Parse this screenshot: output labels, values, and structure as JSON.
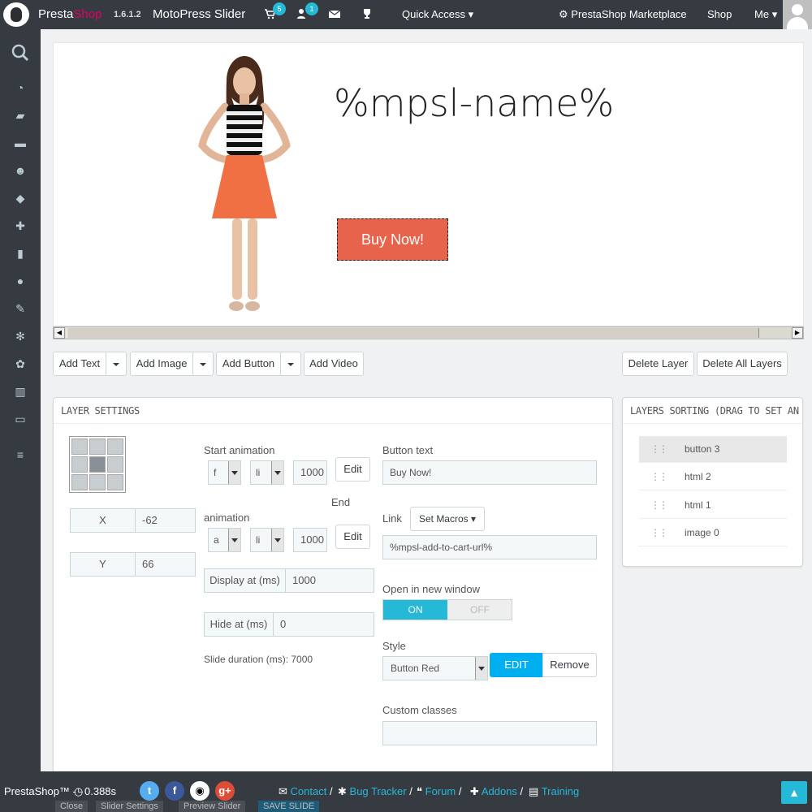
{
  "header": {
    "brand_first": "Presta",
    "brand_second": "Shop",
    "version": "1.6.1.2",
    "page_title": "MotoPress Slider",
    "cart_count": "5",
    "customers_count": "1",
    "quick_access": "Quick Access",
    "marketplace": "PrestaShop Marketplace",
    "shop": "Shop",
    "me": "Me"
  },
  "preview": {
    "title": "%mpsl-name%",
    "button": "Buy Now!"
  },
  "toolbar": {
    "add_text": "Add Text",
    "add_image": "Add Image",
    "add_button": "Add Button",
    "add_video": "Add Video",
    "delete_layer": "Delete Layer",
    "delete_all": "Delete All Layers"
  },
  "layer_settings": {
    "title": "LAYER SETTINGS",
    "x_label": "X",
    "x_value": "-62",
    "y_label": "Y",
    "y_value": "66",
    "start_animation_label": "Start animation",
    "start_effect": "f",
    "start_easing": "li",
    "start_duration": "1000",
    "edit": "Edit",
    "end_word": "End",
    "end_animation_label": "animation",
    "end_effect": "a",
    "end_easing": "li",
    "end_duration": "1000",
    "display_label": "Display at (ms)",
    "display_value": "1000",
    "hide_label": "Hide at (ms)",
    "hide_value": "0",
    "slide_duration": "Slide duration (ms): 7000",
    "button_text_label": "Button text",
    "button_text_value": "Buy Now!",
    "link_label": "Link",
    "set_macros": "Set Macros",
    "link_value": "%mpsl-add-to-cart-url%",
    "new_window_label": "Open in new window",
    "on": "ON",
    "off": "OFF",
    "style_label": "Style",
    "style_value": "Button Red",
    "style_edit": "EDIT",
    "style_remove": "Remove",
    "custom_classes_label": "Custom classes",
    "custom_classes_value": ""
  },
  "layers_sorting": {
    "title": "LAYERS SORTING (DRAG TO SET AN ORDER)",
    "items": [
      "button 3",
      "html 2",
      "html 1",
      "image 0"
    ]
  },
  "footer": {
    "brand": "PrestaShop™ - ",
    "time": "0.388s",
    "contact": "Contact",
    "bug_tracker": "Bug Tracker",
    "forum": "Forum",
    "addons": "Addons",
    "training": "Training",
    "sep": "/",
    "under_buttons": [
      "Close",
      "Slider Settings",
      "Preview Slider",
      "SAVE SLIDE"
    ]
  },
  "colors": {
    "accent": "#25b9d7",
    "dark": "#363a41",
    "buy_button": "#e8634b"
  }
}
